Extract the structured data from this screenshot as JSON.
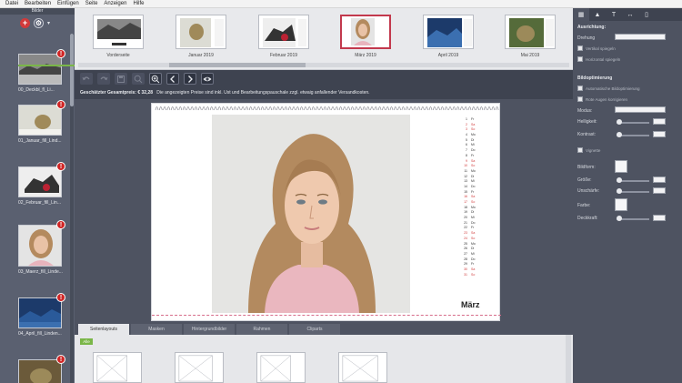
{
  "menu": [
    "Datei",
    "Bearbeiten",
    "Einfügen",
    "Seite",
    "Anzeigen",
    "Hilfe"
  ],
  "sidebar": {
    "header": "Bilder",
    "items": [
      {
        "caption": "00_Deckbl_fl_Li...",
        "badge": "!"
      },
      {
        "caption": "01_Januar_fill_Lind...",
        "badge": "!"
      },
      {
        "caption": "02_Februar_fill_Lin...",
        "badge": "!"
      },
      {
        "caption": "03_Maerz_fill_Linde...",
        "badge": "!"
      },
      {
        "caption": "04_April_fill_Linden...",
        "badge": "!"
      },
      {
        "caption": "",
        "badge": "!"
      }
    ]
  },
  "pages": [
    {
      "label": "Vorderseite",
      "selected": false
    },
    {
      "label": "Januar 2019",
      "selected": false
    },
    {
      "label": "Februar 2019",
      "selected": false
    },
    {
      "label": "März 2019",
      "selected": true
    },
    {
      "label": "April 2019",
      "selected": false
    },
    {
      "label": "Mai 2019",
      "selected": false
    }
  ],
  "price": {
    "label": "Geschätzter Gesamtpreis: € 32,28",
    "note": "Die angezeigten Preise sind inkl. Ust und Bearbeitungspauschale zzgl. etwaig anfallender Versandkosten."
  },
  "calendar": {
    "month": "März",
    "days": [
      {
        "d": "1",
        "w": "Fr",
        "we": false
      },
      {
        "d": "2",
        "w": "Sa",
        "we": true
      },
      {
        "d": "3",
        "w": "So",
        "we": true
      },
      {
        "d": "4",
        "w": "Mo",
        "we": false
      },
      {
        "d": "5",
        "w": "Di",
        "we": false
      },
      {
        "d": "6",
        "w": "Mi",
        "we": false
      },
      {
        "d": "7",
        "w": "Do",
        "we": false
      },
      {
        "d": "8",
        "w": "Fr",
        "we": false
      },
      {
        "d": "9",
        "w": "Sa",
        "we": true
      },
      {
        "d": "10",
        "w": "So",
        "we": true
      },
      {
        "d": "11",
        "w": "Mo",
        "we": false
      },
      {
        "d": "12",
        "w": "Di",
        "we": false
      },
      {
        "d": "13",
        "w": "Mi",
        "we": false
      },
      {
        "d": "14",
        "w": "Do",
        "we": false
      },
      {
        "d": "15",
        "w": "Fr",
        "we": false
      },
      {
        "d": "16",
        "w": "Sa",
        "we": true
      },
      {
        "d": "17",
        "w": "So",
        "we": true
      },
      {
        "d": "18",
        "w": "Mo",
        "we": false
      },
      {
        "d": "19",
        "w": "Di",
        "we": false
      },
      {
        "d": "20",
        "w": "Mi",
        "we": false
      },
      {
        "d": "21",
        "w": "Do",
        "we": false
      },
      {
        "d": "22",
        "w": "Fr",
        "we": false
      },
      {
        "d": "23",
        "w": "Sa",
        "we": true
      },
      {
        "d": "24",
        "w": "So",
        "we": true
      },
      {
        "d": "25",
        "w": "Mo",
        "we": false
      },
      {
        "d": "26",
        "w": "Di",
        "we": false
      },
      {
        "d": "27",
        "w": "Mi",
        "we": false
      },
      {
        "d": "28",
        "w": "Do",
        "we": false
      },
      {
        "d": "29",
        "w": "Fr",
        "we": false
      },
      {
        "d": "30",
        "w": "Sa",
        "we": true
      },
      {
        "d": "31",
        "w": "So",
        "we": true
      }
    ]
  },
  "bottom_tabs": [
    "Seitenlayouts",
    "Masken",
    "Hintergrundbilder",
    "Rahmen",
    "Cliparts"
  ],
  "layouts": {
    "filter": "Alle"
  },
  "right_panel": {
    "tabs": [
      "image-icon",
      "landscape-icon",
      "text-icon",
      "arrows-icon",
      "page-icon"
    ],
    "section_alignment": "Ausrichtung:",
    "rotation_label": "Drehung",
    "flip_vertical": "Vertikal spiegeln",
    "flip_horizontal": "Horizontal spiegeln",
    "section_optimization": "Bildoptimierung",
    "auto_optimize": "Automatische Bildoptimierung",
    "red_eye": "Rote Augen korrigieren",
    "mode_label": "Modus:",
    "brightness_label": "Helligkeit:",
    "contrast_label": "Kontrast:",
    "vignette_label": "Vignette",
    "shape_label": "Bildform:",
    "size_label": "Größe:",
    "blur_label": "Unschärfe:",
    "color_label": "Farbe:",
    "opacity_label": "Deckkraft:"
  },
  "colors": {
    "accent_green": "#7ab648",
    "badge_red": "#d02525",
    "selected_border": "#c2394d",
    "sidebar_bg": "#5a6070",
    "workspace_bg": "#4e5361"
  }
}
